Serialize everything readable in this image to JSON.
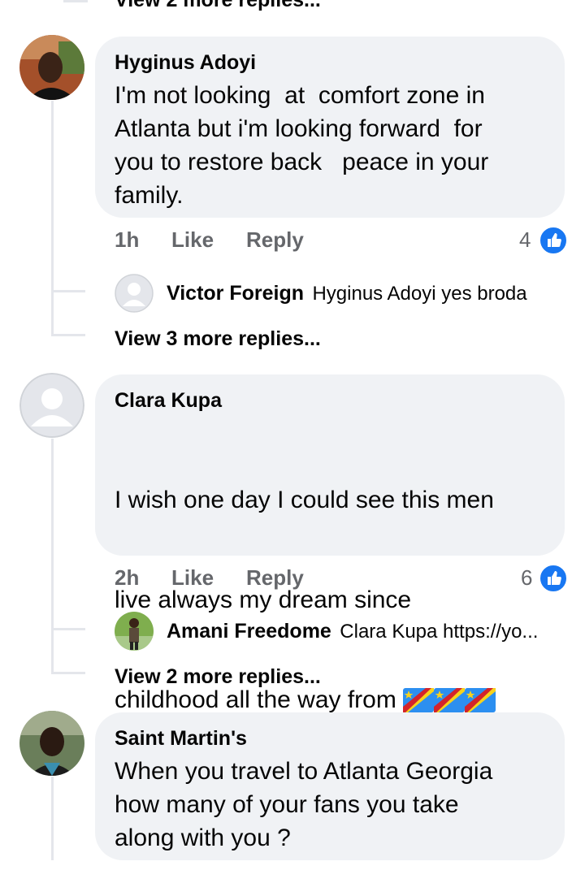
{
  "top_more_replies": "View 2 more replies...",
  "comments": [
    {
      "author": "Hyginus Adoyi",
      "text": "I'm not looking  at  comfort zone in\nAtlanta but i'm looking forward  for\nyou to restore back   peace in your\nfamily.",
      "time": "1h",
      "like_label": "Like",
      "reply_label": "Reply",
      "reactions": "4",
      "reply_preview": {
        "author": "Victor Foreign",
        "text": "Hyginus Adoyi yes broda"
      },
      "more_replies": "View 3 more replies..."
    },
    {
      "author": "Clara Kupa",
      "text_lines": [
        "I wish one day I could see this men",
        "live always my dream since",
        "childhood all the way from "
      ],
      "flag_emoji": "🇨🇩",
      "time": "2h",
      "like_label": "Like",
      "reply_label": "Reply",
      "reactions": "6",
      "reply_preview": {
        "author": "Amani Freedome",
        "text": "Clara Kupa https://yo..."
      },
      "more_replies": "View 2 more replies..."
    },
    {
      "author": "Saint Martin's",
      "text": "When you travel to Atlanta Georgia\nhow many of your fans you take\nalong with you ?"
    }
  ],
  "colors": {
    "bubble": "#f0f2f5",
    "meta": "#65676b",
    "like_blue": "#1877f2",
    "thread_line": "#e4e6eb"
  }
}
